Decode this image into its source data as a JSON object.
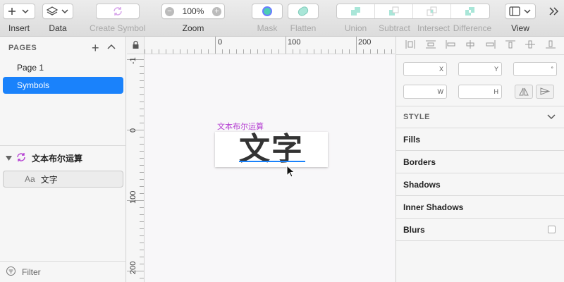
{
  "toolbar": {
    "insert_label": "Insert",
    "data_label": "Data",
    "create_symbol_label": "Create Symbol",
    "zoom_label": "Zoom",
    "zoom_value": "100%",
    "mask_label": "Mask",
    "flatten_label": "Flatten",
    "union_label": "Union",
    "subtract_label": "Subtract",
    "intersect_label": "Intersect",
    "difference_label": "Difference",
    "view_label": "View"
  },
  "pages": {
    "heading": "PAGES",
    "items": [
      {
        "label": "Page 1"
      },
      {
        "label": "Symbols"
      }
    ]
  },
  "layers": {
    "group_label": "文本布尔运算",
    "child_label": "文字",
    "child_type": "Aa"
  },
  "filter": {
    "label": "Filter"
  },
  "rulers": {
    "top": [
      "0",
      "100",
      "200"
    ],
    "left": [
      "-1",
      "0",
      "100",
      "200"
    ]
  },
  "canvas": {
    "artboard_title": "文本布尔运算",
    "text": "文字"
  },
  "inspector": {
    "x_label": "X",
    "y_label": "Y",
    "rotation_label": "°",
    "w_label": "W",
    "h_label": "H",
    "style_heading": "STYLE",
    "sections": [
      "Fills",
      "Borders",
      "Shadows",
      "Inner Shadows",
      "Blurs"
    ]
  },
  "colors": {
    "accent": "#1a82fb",
    "symbol_purple": "#b33bd1",
    "boolean_teal": "#4ccdb5"
  }
}
